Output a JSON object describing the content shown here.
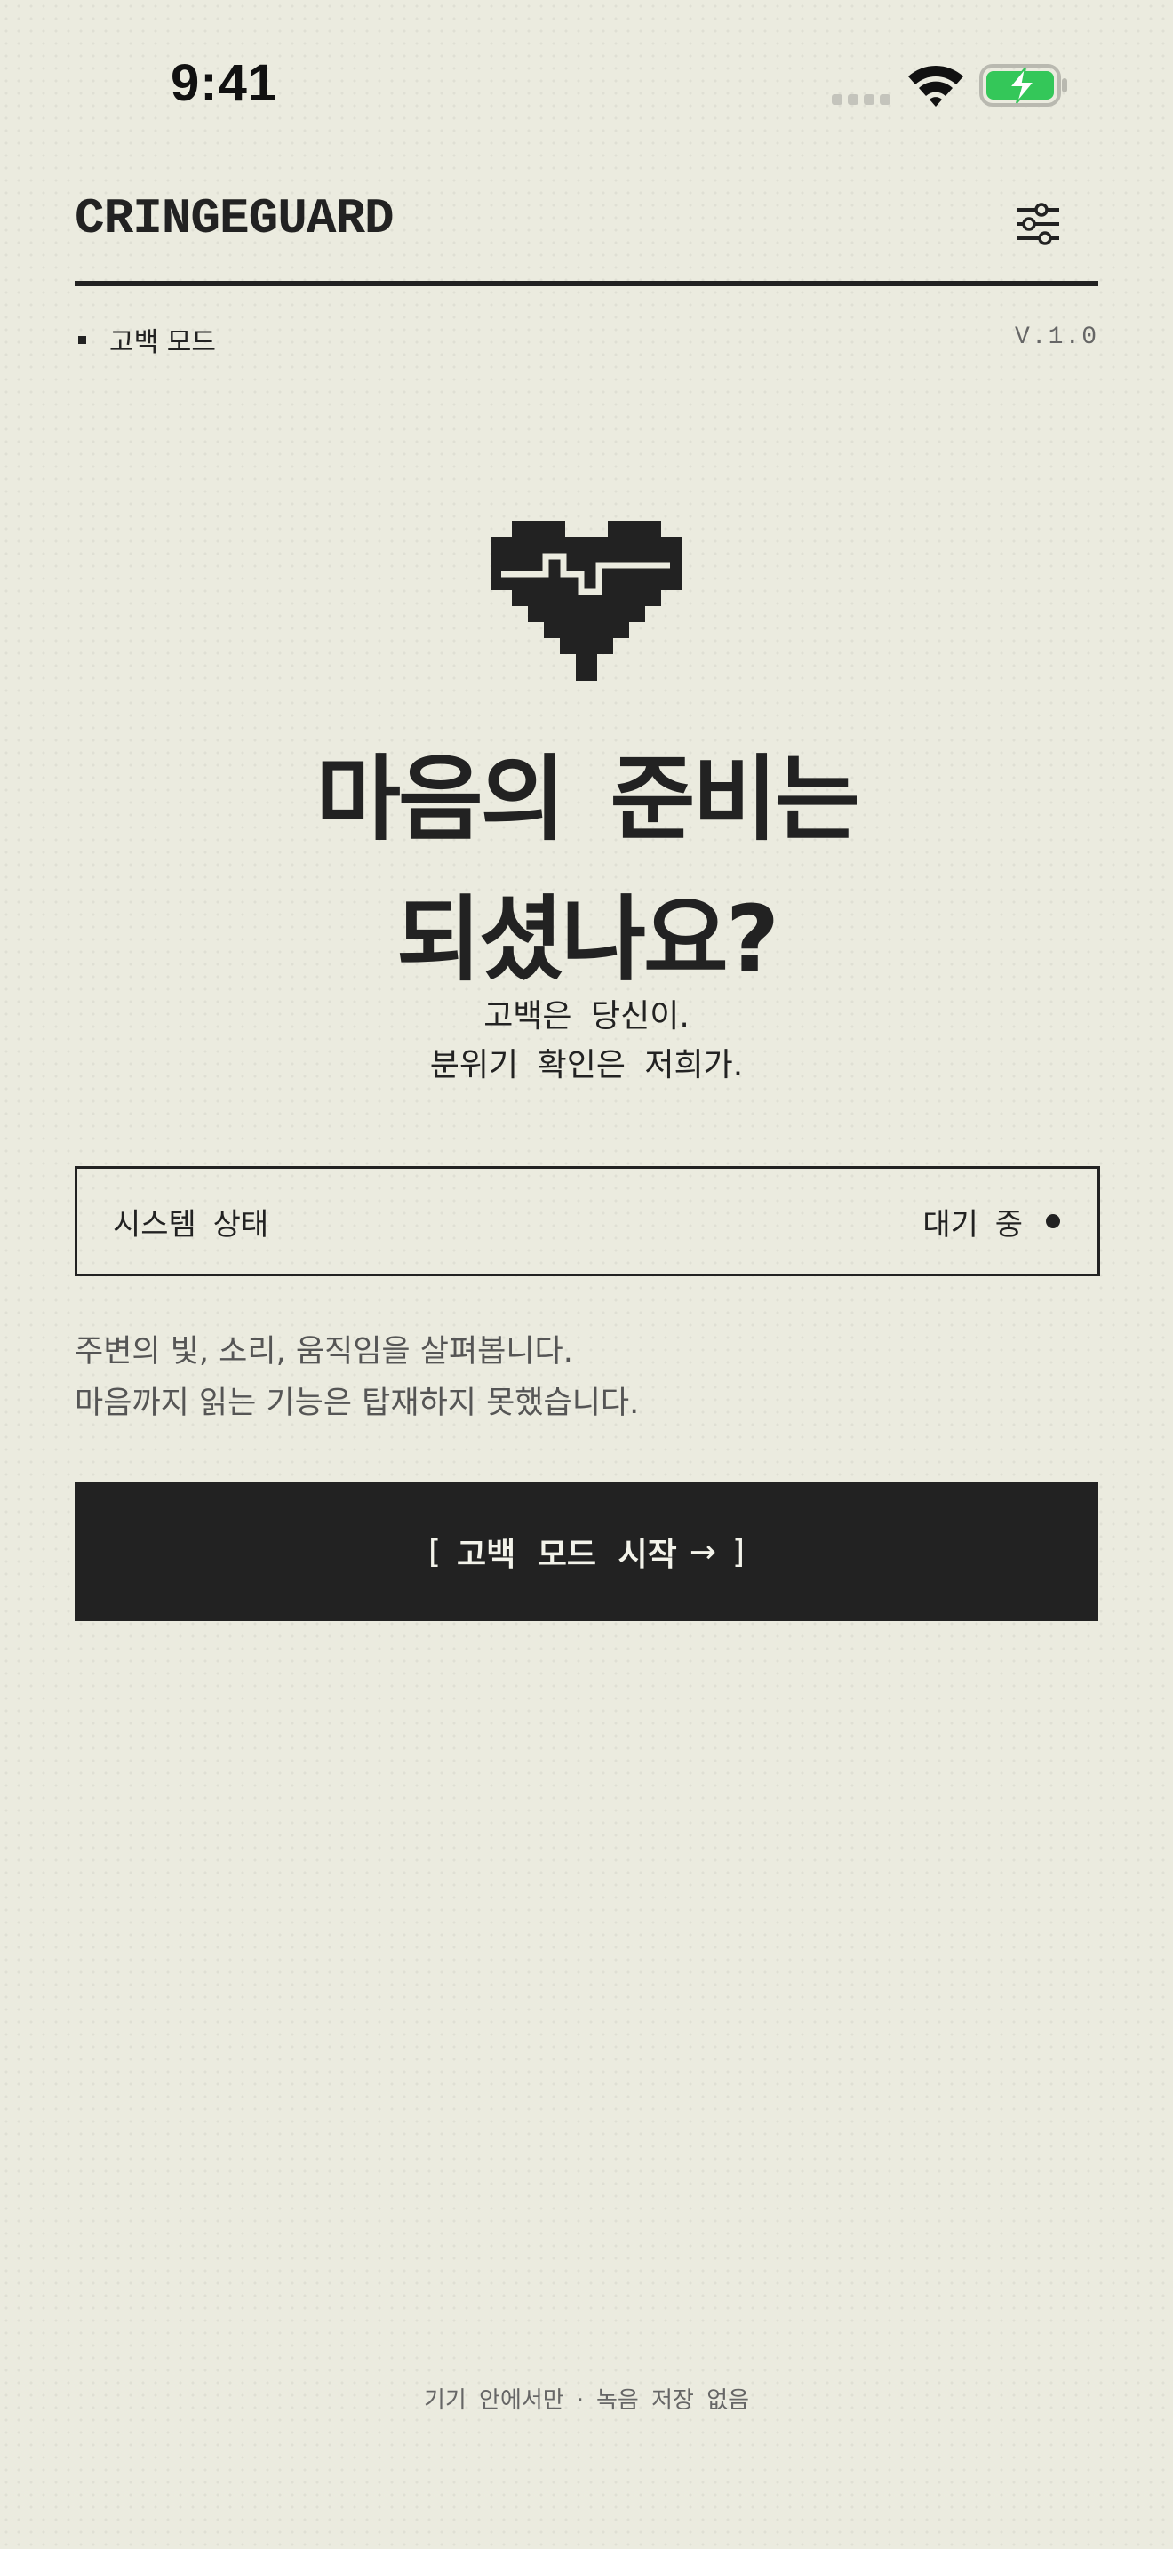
{
  "status_bar": {
    "time": "9:41",
    "icons": [
      "signal-icon",
      "wifi-icon",
      "battery-charging-icon"
    ],
    "battery_color": "#34c759"
  },
  "header": {
    "brand": "CRINGEGUARD",
    "menu_icon": "sliders-icon"
  },
  "mode": {
    "label": "고백 모드",
    "version": "V.1.0"
  },
  "hero": {
    "icon": "pixel-heart-pulse-icon",
    "headline_line1": "마음의 준비는",
    "headline_line2": "되셨나요?",
    "sub_line1": "고백은 당신이.",
    "sub_line2": "분위기 확인은 저희가."
  },
  "system_status": {
    "label": "시스템 상태",
    "value": "대기 중"
  },
  "description": {
    "line1": "주변의 빛, 소리, 움직임을 살펴봅니다.",
    "line2": "마음까지 읽는 기능은 탑재하지 못했습니다."
  },
  "cta": {
    "bracket_open": "[",
    "label": "고백 모드 시작",
    "arrow": "→",
    "bracket_close": "]"
  },
  "footer": {
    "part1": "기기 안에서만",
    "separator": "·",
    "part2": "녹음 저장 없음"
  },
  "colors": {
    "background": "#ebebdf",
    "ink": "#222222",
    "muted": "#555555"
  }
}
